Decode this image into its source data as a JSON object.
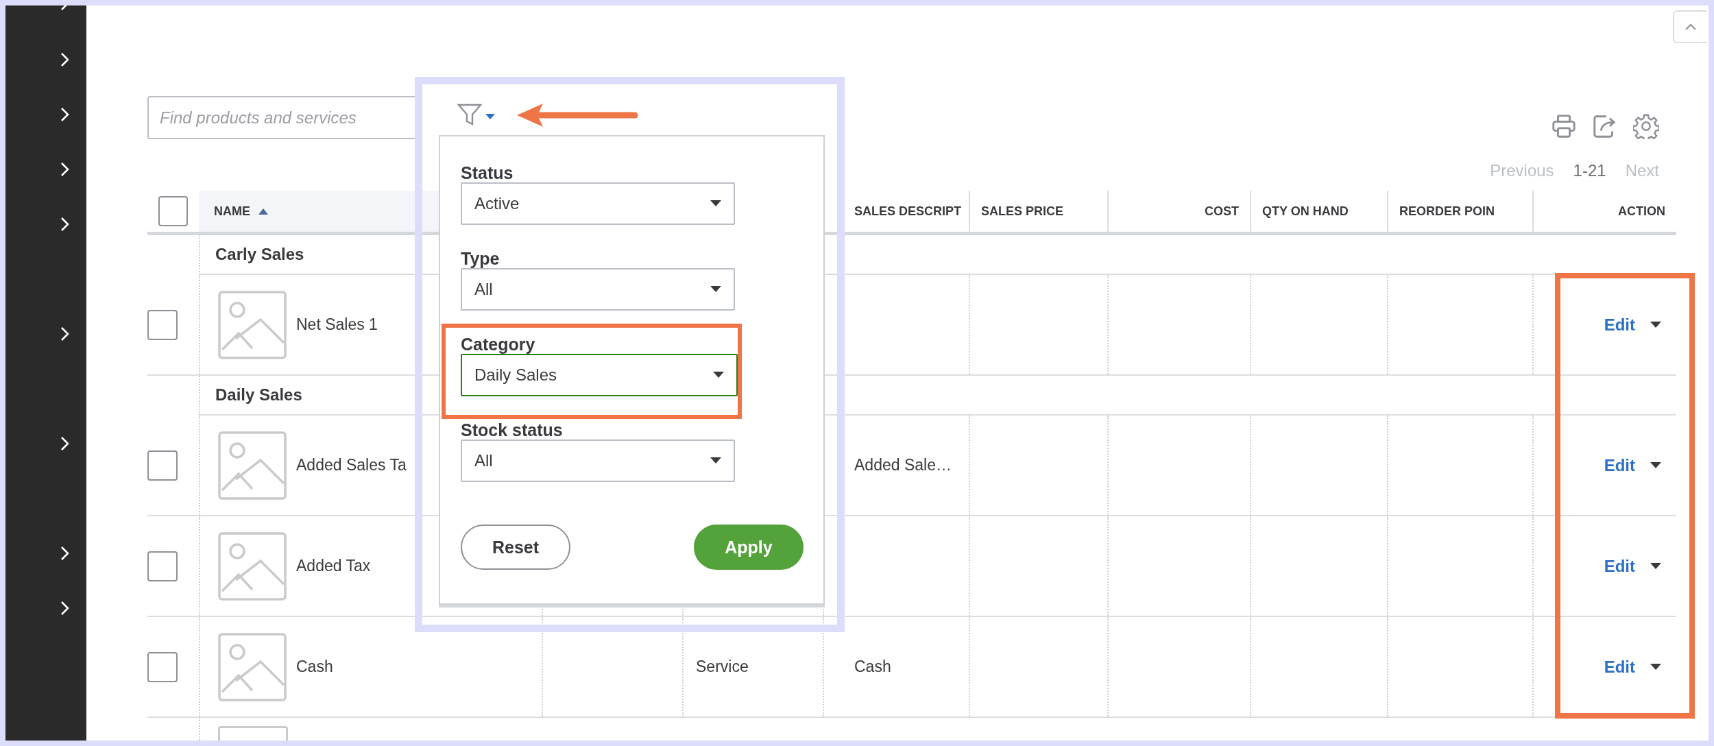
{
  "search": {
    "placeholder": "Find products and services"
  },
  "filter_popover": {
    "fields": [
      {
        "label": "Status",
        "value": "Active",
        "highlighted": false
      },
      {
        "label": "Type",
        "value": "All",
        "highlighted": false
      },
      {
        "label": "Category",
        "value": "Daily Sales",
        "highlighted": true
      },
      {
        "label": "Stock status",
        "value": "All",
        "highlighted": false
      }
    ],
    "buttons": [
      {
        "label": "Reset",
        "kind": "secondary"
      },
      {
        "label": "Apply",
        "kind": "primary"
      }
    ]
  },
  "pagination": {
    "previous": {
      "label": "Previous",
      "disabled": true
    },
    "range": "1-21",
    "next": {
      "label": "Next",
      "disabled": true
    }
  },
  "table": {
    "select_all": {
      "checked": false
    },
    "columns": [
      {
        "label": "NAME",
        "sorted": true
      },
      {
        "label": "SALES DESCRIPT"
      },
      {
        "label": "SALES PRICE"
      },
      {
        "label": "COST"
      },
      {
        "label": "QTY ON HAND"
      },
      {
        "label": "REORDER POIN"
      },
      {
        "label": "ACTION"
      }
    ],
    "groups": [
      {
        "name": "Carly Sales",
        "items": [
          {
            "name": "Net Sales 1",
            "checked": false,
            "action": "Edit"
          }
        ]
      },
      {
        "name": "Daily Sales",
        "items": [
          {
            "name": "Added Sales Ta",
            "checked": false,
            "description": "Added Sale…",
            "action": "Edit"
          },
          {
            "name": "Added Tax",
            "checked": false,
            "action": "Edit"
          },
          {
            "name": "Cash",
            "checked": false,
            "type": "Service",
            "description": "Cash",
            "action": "Edit"
          }
        ]
      }
    ]
  }
}
